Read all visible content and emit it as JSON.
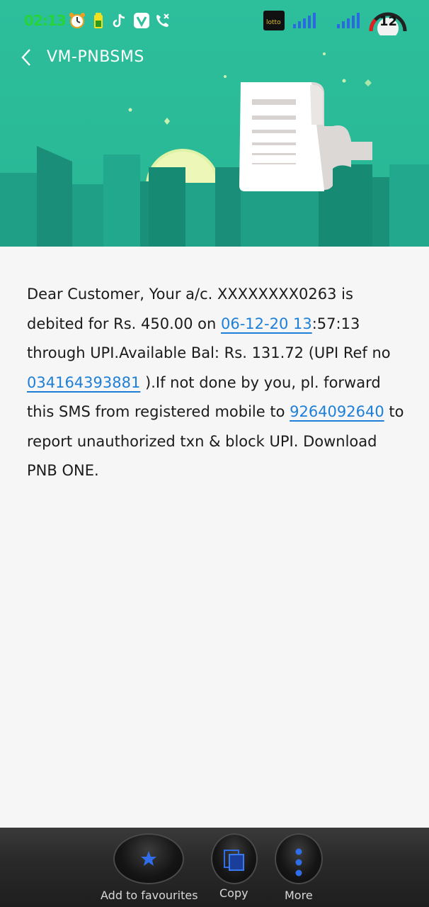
{
  "statusbar": {
    "time": "02:13",
    "battery_level": "12",
    "icons": [
      "alarm-clock-icon",
      "battery-saver-icon",
      "tiktok-icon",
      "vidmate-icon",
      "missed-call-icon",
      "app-badge-icon",
      "signal-bars-icon",
      "signal-bars-icon"
    ]
  },
  "header": {
    "title": "VM-PNBSMS",
    "back_icon": "chevron-left-icon"
  },
  "message": {
    "p1": "Dear Customer, Your  a/c. XXXXXXXX0263 is debited for Rs. 450.00 on ",
    "link_date": "06-12-20 13",
    "p2": ":57:13 through UPI.Available Bal: Rs. 131.72 (UPI Ref no ",
    "link_ref": "034164393881",
    "p3": " ).If not done by you, pl. forward this SMS from registered mobile to ",
    "link_phone": "9264092640",
    "p4": " to report unauthorized txn & block UPI. Download PNB ONE."
  },
  "bottom_actions": {
    "favourite_label": "Add to favourites",
    "copy_label": "Copy",
    "more_label": "More"
  },
  "colors": {
    "header_bg": "#2dbe9c",
    "link": "#1e7fd8",
    "time_green": "#25d33a",
    "accent_blue": "#2f6ee8"
  }
}
